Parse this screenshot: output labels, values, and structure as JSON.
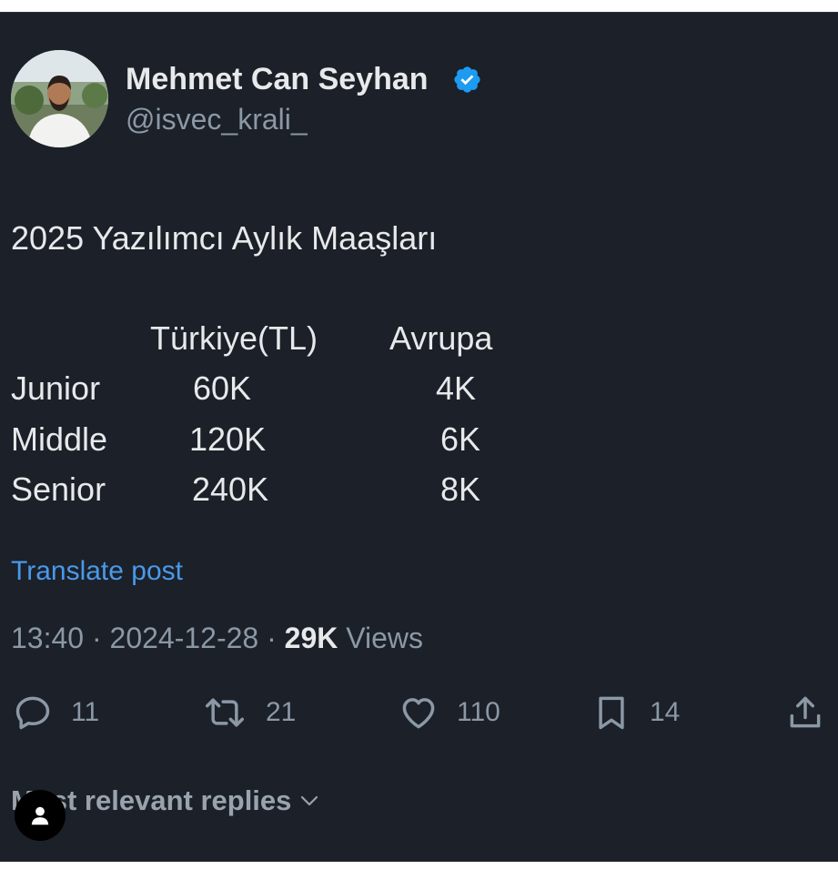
{
  "author": {
    "name": "Mehmet Can Seyhan",
    "handle": "@isvec_krali_",
    "verified_color": "#1d9bf0"
  },
  "post": {
    "title": "2025 Yazılımcı Aylık Maaşları",
    "table": {
      "headers": [
        "",
        "Türkiye(TL)",
        "Avrupa"
      ],
      "rows": [
        [
          "Junior",
          "60K",
          "4K"
        ],
        [
          "Middle",
          "120K",
          "6K"
        ],
        [
          "Senior",
          "240K",
          "8K"
        ]
      ]
    }
  },
  "translate_label": "Translate post",
  "meta": {
    "time": "13:40",
    "separator": " · ",
    "date": "2024-12-28",
    "views_count": "29K",
    "views_label": "Views"
  },
  "actions": {
    "replies": "11",
    "reposts": "21",
    "likes": "110",
    "bookmarks": "14"
  },
  "replies_sort_label": "Most relevant replies",
  "colors": {
    "background": "#1b2029",
    "text": "#e7e9ea",
    "muted": "#8b98a5",
    "link": "#4a99e9"
  }
}
